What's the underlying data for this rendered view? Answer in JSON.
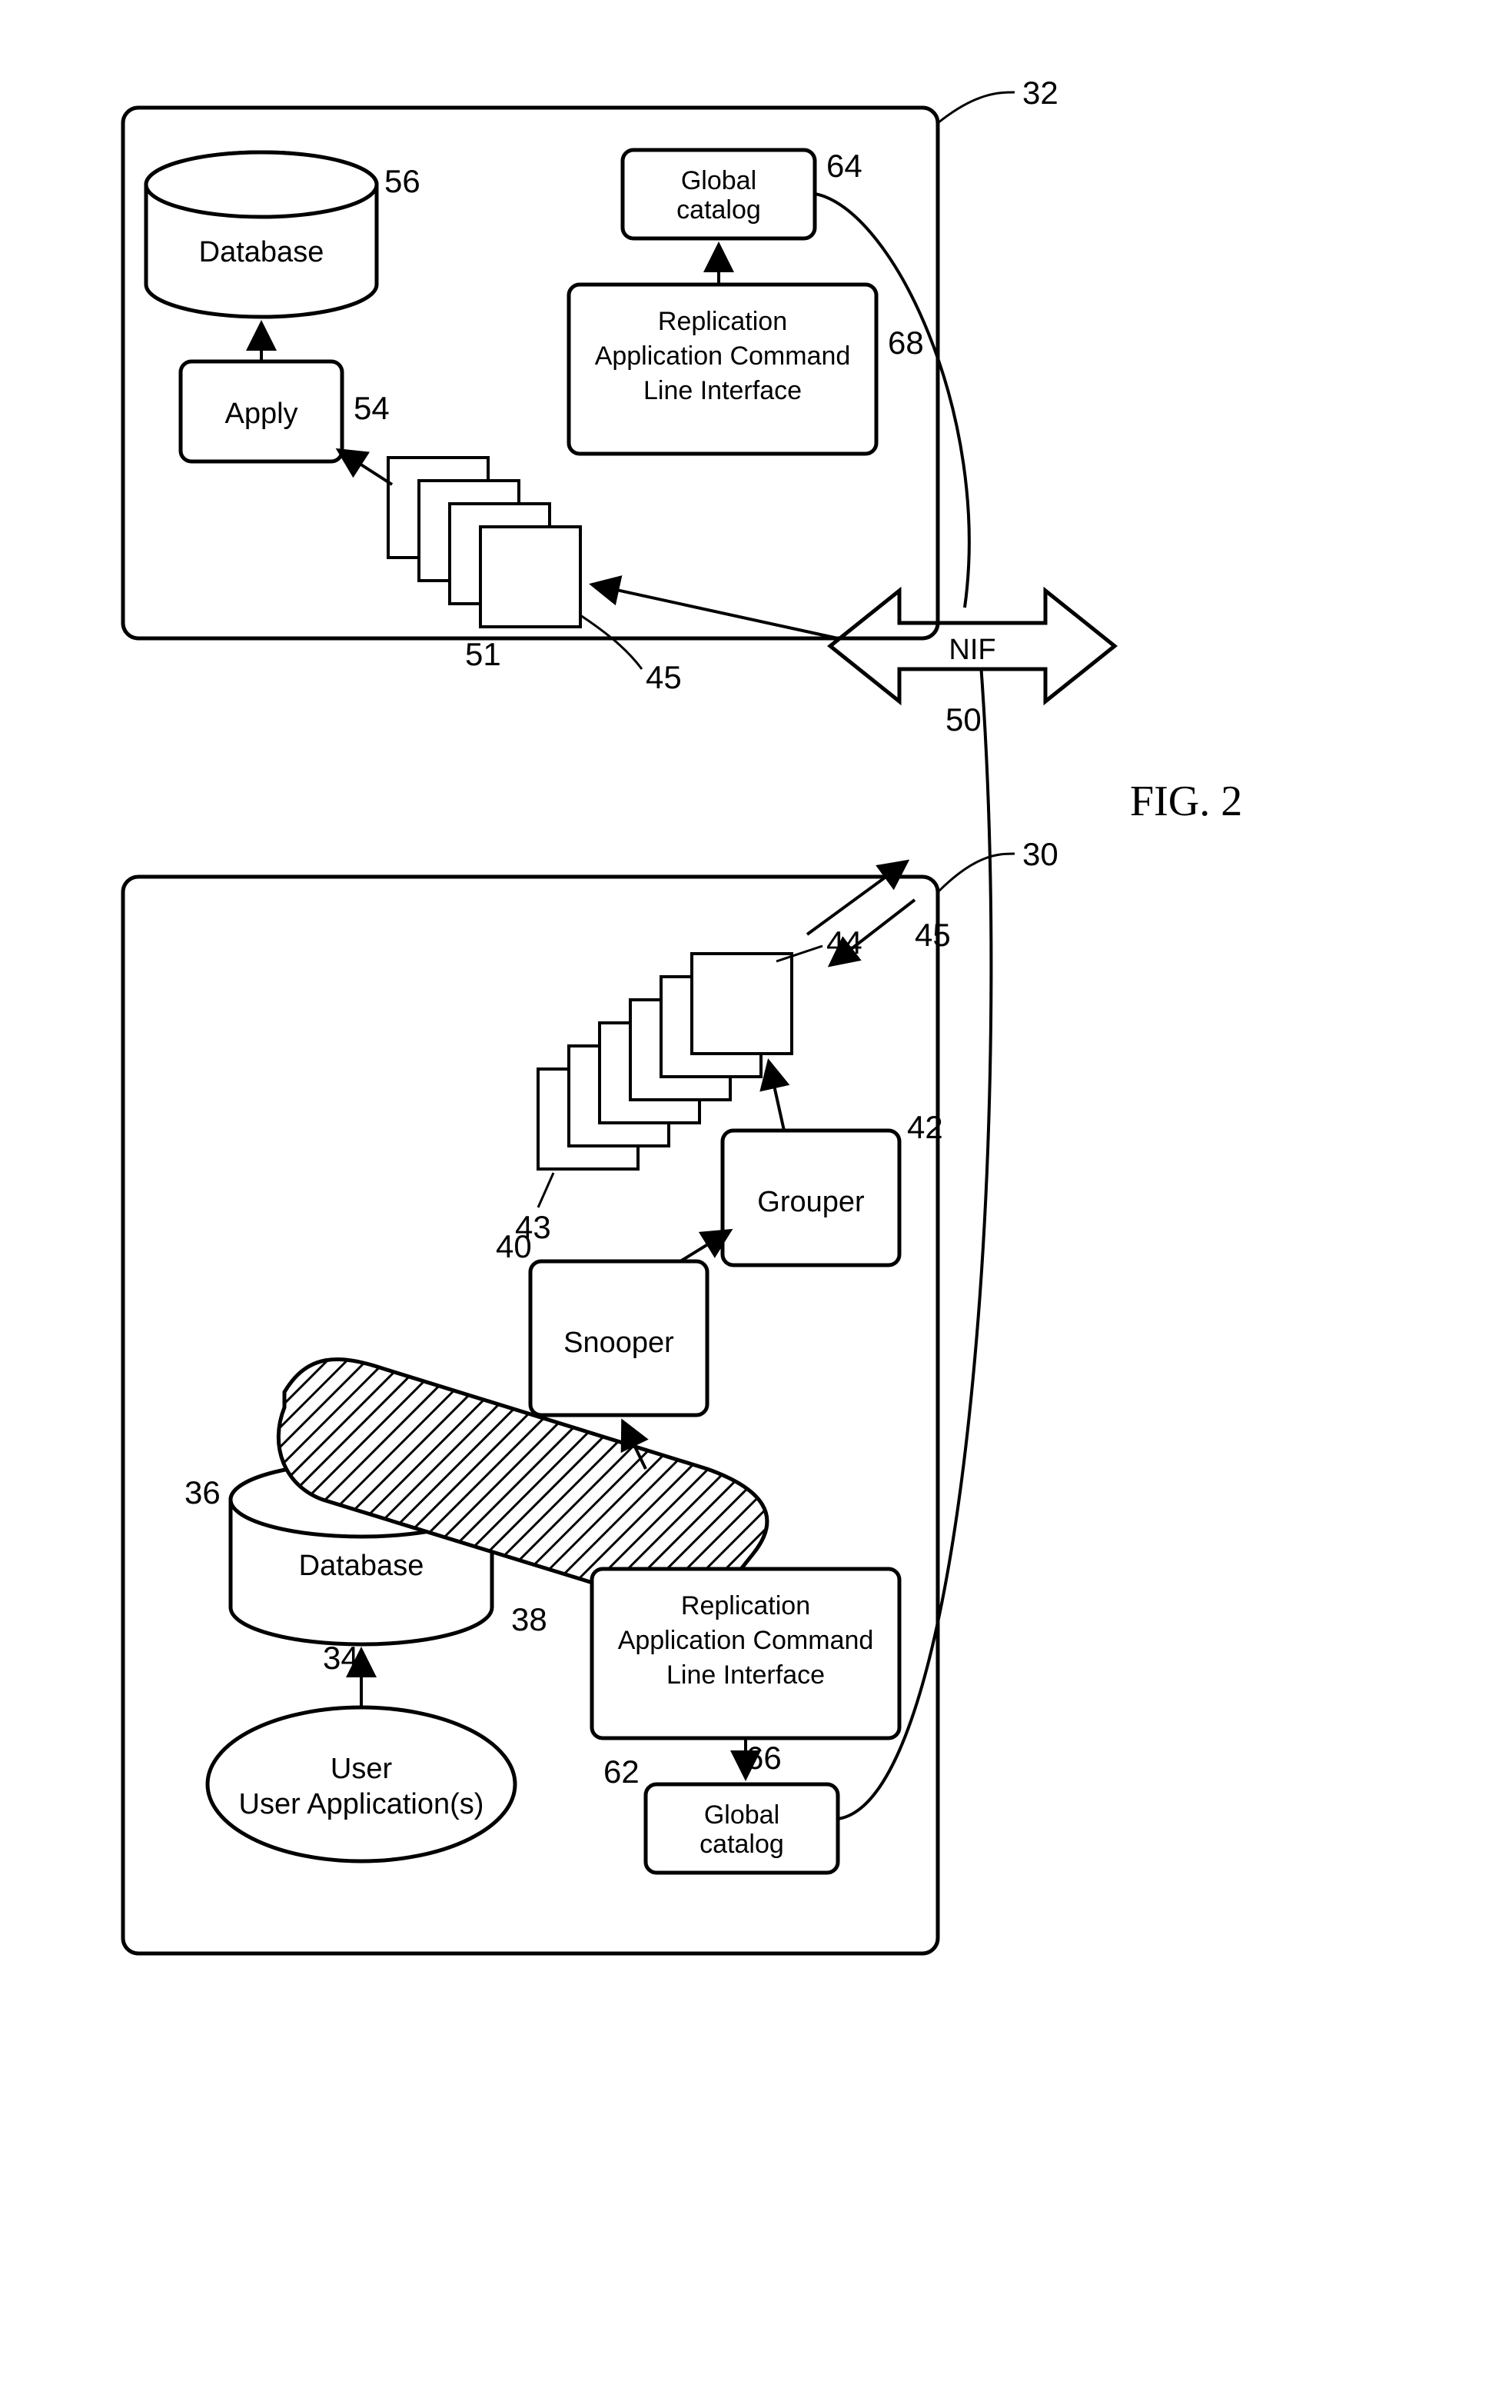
{
  "figure_label": "FIG. 2",
  "refs": {
    "outer_left": "30",
    "outer_right": "32",
    "user_app": "34",
    "db_left": "36",
    "tape": "38",
    "snooper": "40",
    "grouper": "42",
    "stack_a_last": "43",
    "stack_a_first": "44",
    "arrow_queue_left": "45",
    "nif": "50",
    "stack_b_first": "51",
    "arrow_queue_right": "45",
    "apply": "54",
    "db_right": "56",
    "gc_left": "62",
    "gc_right": "64",
    "rcli_left": "66",
    "rcli_right": "68"
  },
  "labels": {
    "user_app": "User Application(s)",
    "database": "Database",
    "snooper": "Snooper",
    "grouper": "Grouper",
    "global_catalog": "Global catalog",
    "rcli_l1": "Replication",
    "rcli_l2": "Application Command",
    "rcli_l3": "Line Interface",
    "nif": "NIF",
    "apply": "Apply"
  }
}
